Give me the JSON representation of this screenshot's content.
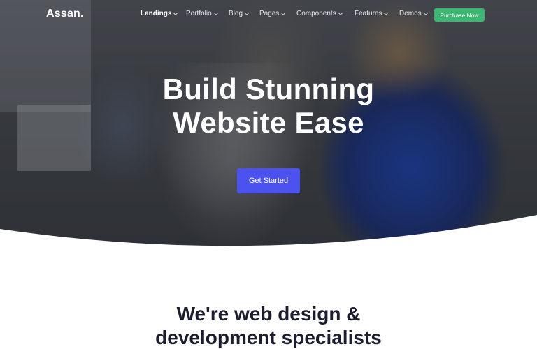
{
  "brand": {
    "logo": "Assan."
  },
  "nav": {
    "items": [
      {
        "label": "Landings",
        "active": true
      },
      {
        "label": "Portfolio"
      },
      {
        "label": "Blog"
      },
      {
        "label": "Pages"
      },
      {
        "label": "Components"
      },
      {
        "label": "Features"
      },
      {
        "label": "Demos"
      }
    ],
    "purchase_label": "Purchase Now"
  },
  "hero": {
    "title_line1": "Build Stunning",
    "title_line2": "Website Ease",
    "cta_label": "Get Started"
  },
  "intro": {
    "title_line1": "We're web design &",
    "title_line2": "development specialists"
  },
  "colors": {
    "accent": "#4c52f0",
    "purchase": "#3bb773",
    "heading": "#1b1d2e"
  },
  "icons": {
    "nav_dropdown": "chevron-down-icon"
  }
}
